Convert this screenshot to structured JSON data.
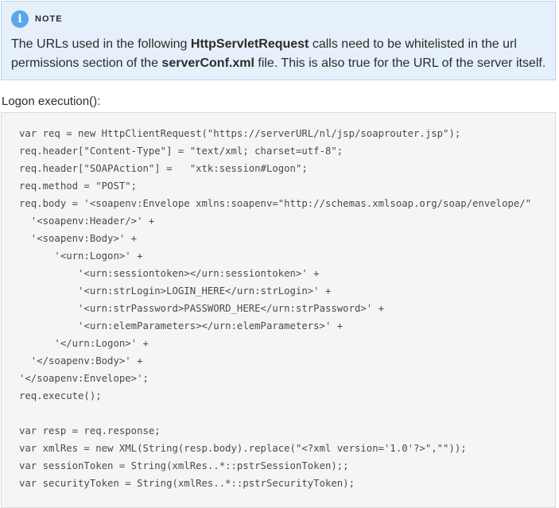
{
  "note": {
    "icon": "info-icon",
    "icon_glyph": "i",
    "label": "NOTE",
    "text_part1": "The URLs used in the following ",
    "bold1": "HttpServletRequest",
    "text_part2": " calls need to be whitelisted in the url permissions section of the ",
    "bold2": "serverConf.xml",
    "text_part3": " file. This is also true for the URL of the server itself."
  },
  "caption": "Logon execution():",
  "code_lines": [
    "var req = new HttpClientRequest(\"https://serverURL/nl/jsp/soaprouter.jsp\");",
    "req.header[\"Content-Type\"] = \"text/xml; charset=utf-8\";",
    "req.header[\"SOAPAction\"] =   \"xtk:session#Logon\";",
    "req.method = \"POST\";",
    "req.body = '<soapenv:Envelope xmlns:soapenv=\"http://schemas.xmlsoap.org/soap/envelope/\"",
    "  '<soapenv:Header/>' +",
    "  '<soapenv:Body>' +",
    "      '<urn:Logon>' +",
    "          '<urn:sessiontoken></urn:sessiontoken>' +",
    "          '<urn:strLogin>LOGIN_HERE</urn:strLogin>' +",
    "          '<urn:strPassword>PASSWORD_HERE</urn:strPassword>' +",
    "          '<urn:elemParameters></urn:elemParameters>' +",
    "      '</urn:Logon>' +",
    "  '</soapenv:Body>' +",
    "'</soapenv:Envelope>';",
    "req.execute();",
    "",
    "var resp = req.response;",
    "var xmlRes = new XML(String(resp.body).replace(\"<?xml version='1.0'?>\",\"\"));",
    "var sessionToken = String(xmlRes..*::pstrSessionToken);;",
    "var securityToken = String(xmlRes..*::pstrSecurityToken);"
  ]
}
